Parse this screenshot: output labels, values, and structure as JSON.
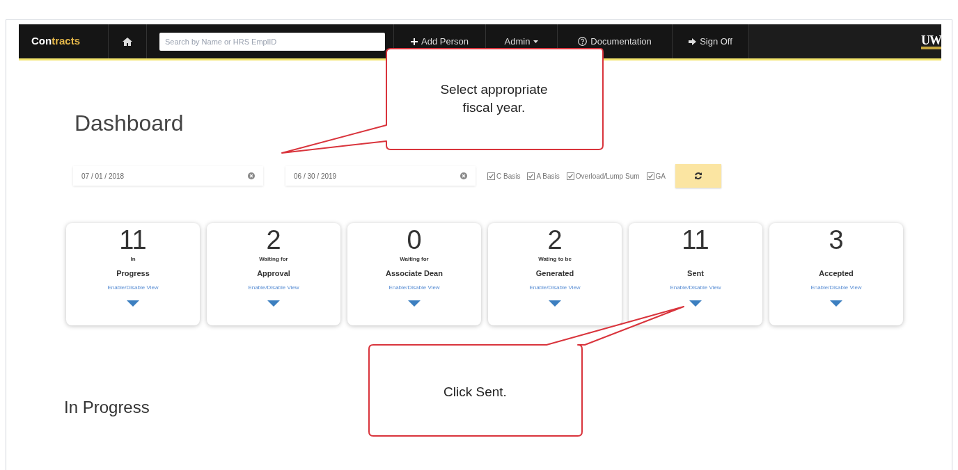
{
  "navbar": {
    "brand": {
      "lead": "Con",
      "rest": "tracts"
    },
    "search": {
      "placeholder": "Search by Name or HRS EmplID"
    },
    "items": [
      {
        "kind": "add",
        "label": "Add Person"
      },
      {
        "kind": "dropdown",
        "label": "Admin"
      },
      {
        "kind": "help",
        "label": "Documentation"
      },
      {
        "kind": "signoff",
        "label": "Sign Off"
      }
    ],
    "logo": "UW"
  },
  "page": {
    "title": "Dashboard"
  },
  "filters": {
    "start_date": "07 / 01 / 2018",
    "end_date": "06 / 30 / 2019",
    "checkboxes": [
      {
        "label": "C Basis",
        "checked": true
      },
      {
        "label": "A Basis",
        "checked": true
      },
      {
        "label": "Overload/Lump Sum",
        "checked": true
      },
      {
        "label": "GA",
        "checked": true
      }
    ]
  },
  "cards": [
    {
      "count": "11",
      "subtitle": "In",
      "title": "Progress",
      "link": "Enable/Disable View"
    },
    {
      "count": "2",
      "subtitle": "Waiting for",
      "title": "Approval",
      "link": "Enable/Disable View"
    },
    {
      "count": "0",
      "subtitle": "Waiting for",
      "title": "Associate Dean",
      "link": "Enable/Disable View"
    },
    {
      "count": "2",
      "subtitle": "Wating to be",
      "title": "Generated",
      "link": "Enable/Disable View"
    },
    {
      "count": "11",
      "title": "Sent",
      "link": "Enable/Disable View"
    },
    {
      "count": "3",
      "title": "Accepted",
      "link": "Enable/Disable View"
    }
  ],
  "section_heading": "In Progress",
  "callouts": [
    {
      "text": "Select appropriate fiscal year."
    },
    {
      "text": "Click Sent."
    }
  ]
}
